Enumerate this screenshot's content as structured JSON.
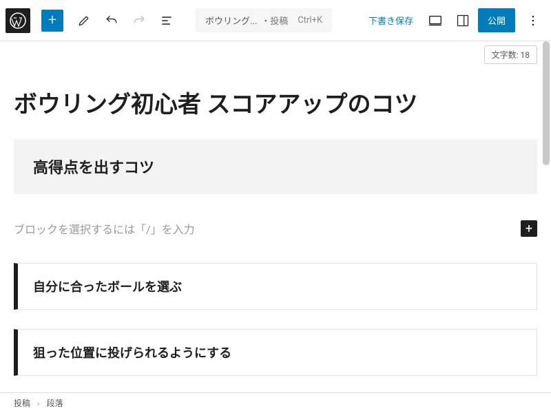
{
  "toolbar": {
    "doc_title": "ボウリング...",
    "doc_type": "・投稿",
    "shortcut": "Ctrl+K",
    "save_draft": "下書き保存",
    "publish": "公開"
  },
  "word_count": {
    "label": "文字数:",
    "value": "18"
  },
  "content": {
    "title": "ボウリング初心者 スコアアップのコツ",
    "heading1": "高得点を出すコツ",
    "placeholder": "ブロックを選択するには「/」を入力",
    "block1": "自分に合ったボールを選ぶ",
    "block2": "狙った位置に投げられるようにする"
  },
  "breadcrumb": {
    "root": "投稿",
    "current": "段落"
  }
}
